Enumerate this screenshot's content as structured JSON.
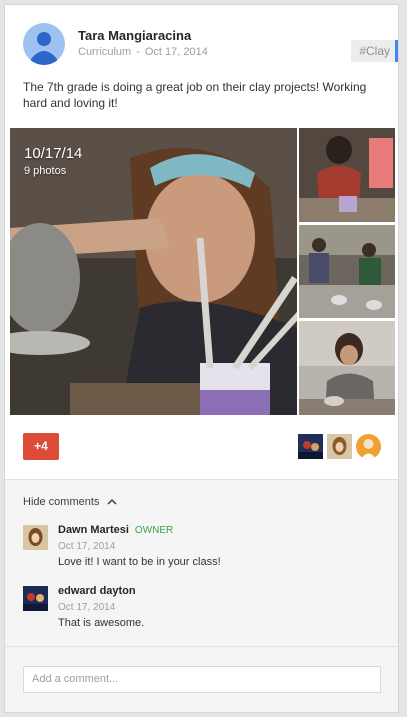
{
  "post": {
    "author": "Tara Mangiaracina",
    "category": "Curriculum",
    "date": "Oct 17, 2014",
    "hashtag": "#Clay",
    "text": "The 7th grade is doing a great job on their clay projects! Working hard and loving it!"
  },
  "album": {
    "date": "10/17/14",
    "count": "9 photos"
  },
  "plusone": {
    "label": "+4"
  },
  "comments": {
    "toggle_label": "Hide comments",
    "items": [
      {
        "author": "Dawn Martesi",
        "badge": "OWNER",
        "date": "Oct 17, 2014",
        "text": "Love it! I want to be in your class!"
      },
      {
        "author": "edward dayton",
        "date": "Oct 17, 2014",
        "text": "That is awesome."
      }
    ],
    "add_placeholder": "Add a comment..."
  },
  "colors": {
    "plus_red": "#dd4b39",
    "owner_green": "#3ea34a",
    "tag_accent": "#4285f4"
  }
}
